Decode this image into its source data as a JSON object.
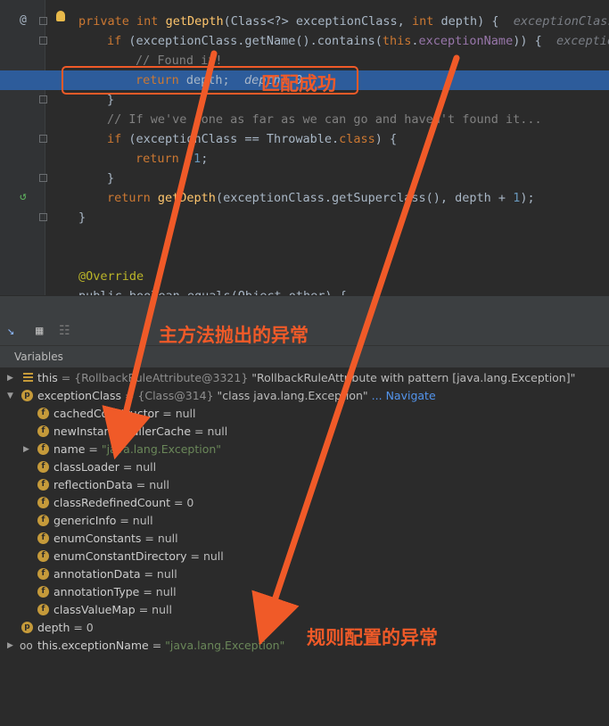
{
  "code": {
    "line1": {
      "kw1": "private",
      "kw2": "int",
      "fn": "getDepth",
      "rest": "(Class<?> exceptionClass, ",
      "kw3": "int",
      "rest2": " depth) {",
      "hint": "exceptionClass"
    },
    "line2": {
      "kw": "if",
      "rest1": " (exceptionClass.getName().contains(",
      "kw2": "this",
      "dot": ".",
      "field": "exceptionName",
      "rest2": ")) {",
      "hint": "exception"
    },
    "line3": {
      "comment": "// Found it!"
    },
    "line4": {
      "kw": "return",
      "rest": " depth;",
      "hint": "depth: 0"
    },
    "line5": {
      "text": "}"
    },
    "line6": {
      "comment": "// If we've gone as far as we can go and haven't found it..."
    },
    "line7": {
      "kw": "if",
      "rest1": " (exceptionClass == Throwable.",
      "kw2": "class",
      "rest2": ") {"
    },
    "line8": {
      "kw": "return",
      "rest1": " -",
      "num": "1",
      "rest2": ";"
    },
    "line9": {
      "text": "}"
    },
    "line10": {
      "kw": "return",
      "fn": " getDepth",
      "rest1": "(exceptionClass.getSuperclass(), depth + ",
      "num": "1",
      "rest2": ");"
    },
    "line11": {
      "text": "}"
    },
    "line12": {
      "ann": "@Override"
    },
    "line13": {
      "text": "public boolean equals(Object other) {"
    }
  },
  "variables_header": "Variables",
  "variables": [
    {
      "name": "this",
      "value": " = {RollbackRuleAttribute@3321} ",
      "extra": "\"RollbackRuleAttribute with pattern [java.lang.Exception]\""
    },
    {
      "name": "exceptionClass",
      "value": " = {Class@314} ",
      "extra": "\"class java.lang.Exception\"",
      "link": "... Navigate"
    },
    {
      "name": "cachedConstructor",
      "value": " = null"
    },
    {
      "name": "newInstanceCallerCache",
      "value": " = null"
    },
    {
      "name": "name",
      "value": " = ",
      "str": "\"java.lang.Exception\""
    },
    {
      "name": "classLoader",
      "value": " = null"
    },
    {
      "name": "reflectionData",
      "value": " = null"
    },
    {
      "name": "classRedefinedCount",
      "value": " = 0"
    },
    {
      "name": "genericInfo",
      "value": " = null"
    },
    {
      "name": "enumConstants",
      "value": " = null"
    },
    {
      "name": "enumConstantDirectory",
      "value": " = null"
    },
    {
      "name": "annotationData",
      "value": " = null"
    },
    {
      "name": "annotationType",
      "value": " = null"
    },
    {
      "name": "classValueMap",
      "value": " = null"
    },
    {
      "name": "depth",
      "value": " = 0"
    },
    {
      "name": "this.exceptionName",
      "value": " = ",
      "str": "\"java.lang.Exception\""
    }
  ],
  "icons": {
    "field": "f",
    "param": "p"
  },
  "annotations": {
    "match": "匹配成功",
    "main_exception": "主方法抛出的异常",
    "rule_exception": "规则配置的异常",
    "color": "#f05a28"
  },
  "gutter": {
    "override_marker": "@",
    "recursion_marker": "↺"
  }
}
